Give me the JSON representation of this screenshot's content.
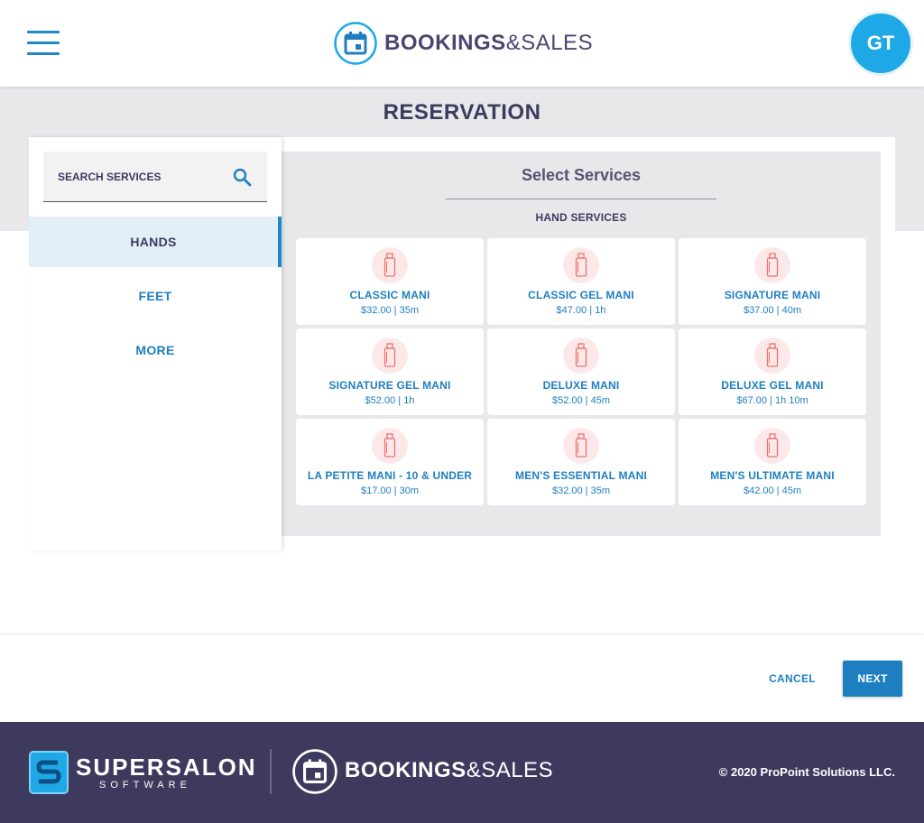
{
  "header": {
    "brand_bold": "BOOKINGS",
    "brand_light": "&SALES",
    "avatar_initials": "GT",
    "accent_color": "#1e88c8"
  },
  "page": {
    "title": "RESERVATION"
  },
  "sidebar": {
    "search_placeholder": "SEARCH SERVICES",
    "categories": [
      {
        "label": "HANDS",
        "active": true
      },
      {
        "label": "FEET",
        "active": false
      },
      {
        "label": "MORE",
        "active": false
      }
    ]
  },
  "services": {
    "title": "Select Services",
    "section_label": "HAND SERVICES",
    "icon": "bottle-icon",
    "items": [
      {
        "name": "CLASSIC MANI",
        "price": "$32.00",
        "duration": "35m"
      },
      {
        "name": "CLASSIC GEL MANI",
        "price": "$47.00",
        "duration": "1h"
      },
      {
        "name": "SIGNATURE MANI",
        "price": "$37.00",
        "duration": "40m"
      },
      {
        "name": "SIGNATURE GEL MANI",
        "price": "$52.00",
        "duration": "1h"
      },
      {
        "name": "DELUXE MANI",
        "price": "$52.00",
        "duration": "45m"
      },
      {
        "name": "DELUXE GEL MANI",
        "price": "$67.00",
        "duration": "1h 10m"
      },
      {
        "name": "LA PETITE MANI - 10 & UNDER",
        "price": "$17.00",
        "duration": "30m"
      },
      {
        "name": "MEN'S ESSENTIAL MANI",
        "price": "$32.00",
        "duration": "35m"
      },
      {
        "name": "MEN'S ULTIMATE MANI",
        "price": "$42.00",
        "duration": "45m"
      }
    ]
  },
  "actions": {
    "cancel_label": "CANCEL",
    "next_label": "NEXT"
  },
  "footer": {
    "supersalon_name": "SUPERSALON",
    "supersalon_sub": "SOFTWARE",
    "brand_bold": "BOOKINGS",
    "brand_light": "&SALES",
    "copyright": "© 2020 ProPoint Solutions LLC.",
    "background_color": "#3d3a5e"
  }
}
